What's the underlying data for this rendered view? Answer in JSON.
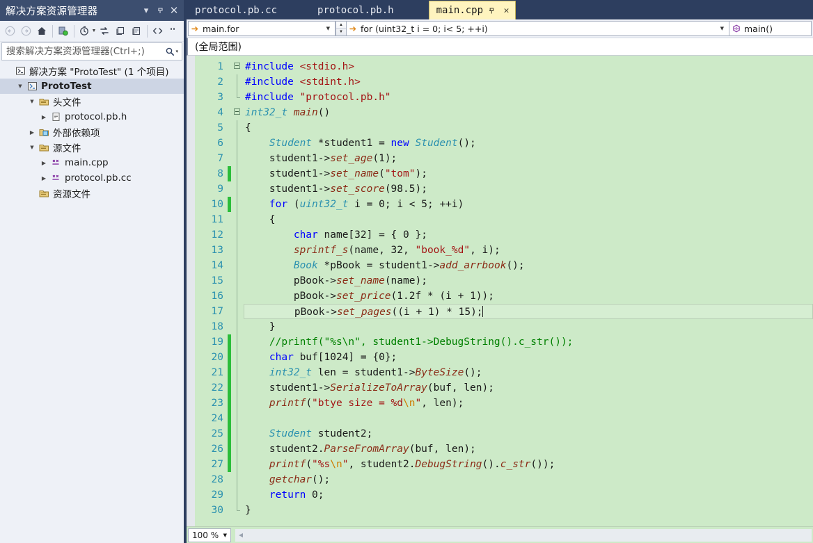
{
  "solution_explorer": {
    "title": "解决方案资源管理器",
    "title_buttons": [
      {
        "name": "dropdown-icon",
        "glyph": "▾"
      },
      {
        "name": "pin-icon",
        "glyph": "⚲"
      },
      {
        "name": "close-icon",
        "glyph": "✕"
      }
    ],
    "toolbar": [
      {
        "name": "back-icon",
        "tip": "后退"
      },
      {
        "name": "forward-icon",
        "tip": "前进"
      },
      {
        "name": "home-icon",
        "tip": "主页"
      },
      {
        "name": "sync-with-active-document-icon",
        "tip": "与活动文档同步"
      },
      {
        "name": "refresh-icon",
        "tip": "刷新"
      },
      {
        "name": "collapse-all-icon",
        "tip": "全部折叠"
      },
      {
        "name": "show-all-files-icon",
        "tip": "显示所有文件"
      },
      {
        "name": "properties-icon",
        "tip": "属性"
      },
      {
        "name": "code-view-icon",
        "tip": "查看代码"
      },
      {
        "name": "overflow-icon",
        "tip": "更多"
      }
    ],
    "search": {
      "placeholder": "搜索解决方案资源管理器(Ctrl+;)",
      "value": "",
      "icon": "search-icon",
      "caret": "▾"
    },
    "tree": [
      {
        "indent": 0,
        "twisty": "",
        "icon": "solution-icon",
        "label": "解决方案 \"ProtoTest\" (1 个项目)",
        "bold": false,
        "selected": false
      },
      {
        "indent": 1,
        "twisty": "▲",
        "icon": "cpp-project-icon",
        "label": "ProtoTest",
        "bold": true,
        "selected": true
      },
      {
        "indent": 2,
        "twisty": "▲",
        "icon": "filter-folder-icon",
        "label": "头文件",
        "bold": false,
        "selected": false
      },
      {
        "indent": 3,
        "twisty": "▶",
        "icon": "header-file-icon",
        "label": "protocol.pb.h",
        "bold": false,
        "selected": false
      },
      {
        "indent": 2,
        "twisty": "▶",
        "icon": "external-deps-icon",
        "label": "外部依赖项",
        "bold": false,
        "selected": false
      },
      {
        "indent": 2,
        "twisty": "▲",
        "icon": "filter-folder-icon",
        "label": "源文件",
        "bold": false,
        "selected": false
      },
      {
        "indent": 3,
        "twisty": "▶",
        "icon": "cpp-file-icon",
        "label": "main.cpp",
        "bold": false,
        "selected": false
      },
      {
        "indent": 3,
        "twisty": "▶",
        "icon": "cpp-file-icon",
        "label": "protocol.pb.cc",
        "bold": false,
        "selected": false
      },
      {
        "indent": 2,
        "twisty": "",
        "icon": "filter-folder-icon",
        "label": "资源文件",
        "bold": false,
        "selected": false
      }
    ]
  },
  "editor": {
    "tabs": [
      {
        "label": "protocol.pb.cc",
        "active": false
      },
      {
        "label": "protocol.pb.h",
        "active": false
      },
      {
        "label": "main.cpp",
        "active": true,
        "pin_glyph": "⚲",
        "close_glyph": "✕"
      }
    ],
    "navbar": {
      "left_value": "main.for",
      "left_icon": "arrow-right-icon",
      "mid_value": "for (uint32_t i = 0; i< 5; ++i)",
      "mid_icon": "arrow-right-icon",
      "right_value": "main()",
      "right_icon": "method-icon",
      "caret_glyph": "▾",
      "spinner_up": "▲",
      "spinner_down": "▼"
    },
    "scope_bar": {
      "value": "(全局范围)"
    },
    "zoom": {
      "value": "100 %",
      "caret": "▾"
    },
    "change_bar_lines": [
      8,
      10,
      19,
      20,
      21,
      22,
      23,
      24,
      25,
      26,
      27
    ],
    "current_line": 17,
    "fold_lines": [
      1,
      4
    ],
    "code": [
      {
        "n": 1,
        "tokens": [
          {
            "t": "ppk",
            "v": "#include"
          },
          {
            "t": "op",
            "v": " "
          },
          {
            "t": "str",
            "v": "<stdio.h>"
          }
        ]
      },
      {
        "n": 2,
        "tokens": [
          {
            "t": "ppk",
            "v": "#include"
          },
          {
            "t": "op",
            "v": " "
          },
          {
            "t": "str",
            "v": "<stdint.h>"
          }
        ]
      },
      {
        "n": 3,
        "tokens": [
          {
            "t": "ppk",
            "v": "#include"
          },
          {
            "t": "op",
            "v": " "
          },
          {
            "t": "str",
            "v": "\"protocol.pb.h\""
          }
        ]
      },
      {
        "n": 4,
        "tokens": [
          {
            "t": "typ",
            "v": "int32_t"
          },
          {
            "t": "op",
            "v": " "
          },
          {
            "t": "gfn",
            "v": "main"
          },
          {
            "t": "op",
            "v": "()"
          }
        ]
      },
      {
        "n": 5,
        "tokens": [
          {
            "t": "op",
            "v": "{"
          }
        ]
      },
      {
        "n": 6,
        "tokens": [
          {
            "t": "op",
            "v": "    "
          },
          {
            "t": "typ",
            "v": "Student"
          },
          {
            "t": "op",
            "v": " *"
          },
          {
            "t": "id",
            "v": "student1"
          },
          {
            "t": "op",
            "v": " = "
          },
          {
            "t": "k",
            "v": "new"
          },
          {
            "t": "op",
            "v": " "
          },
          {
            "t": "typ",
            "v": "Student"
          },
          {
            "t": "op",
            "v": "();"
          }
        ]
      },
      {
        "n": 7,
        "tokens": [
          {
            "t": "op",
            "v": "    "
          },
          {
            "t": "id",
            "v": "student1"
          },
          {
            "t": "op",
            "v": "->"
          },
          {
            "t": "fn",
            "v": "set_age"
          },
          {
            "t": "op",
            "v": "("
          },
          {
            "t": "num",
            "v": "1"
          },
          {
            "t": "op",
            "v": ");"
          }
        ]
      },
      {
        "n": 8,
        "tokens": [
          {
            "t": "op",
            "v": "    "
          },
          {
            "t": "id",
            "v": "student1"
          },
          {
            "t": "op",
            "v": "->"
          },
          {
            "t": "fn",
            "v": "set_name"
          },
          {
            "t": "op",
            "v": "("
          },
          {
            "t": "str",
            "v": "\"tom\""
          },
          {
            "t": "op",
            "v": ");"
          }
        ]
      },
      {
        "n": 9,
        "tokens": [
          {
            "t": "op",
            "v": "    "
          },
          {
            "t": "id",
            "v": "student1"
          },
          {
            "t": "op",
            "v": "->"
          },
          {
            "t": "fn",
            "v": "set_score"
          },
          {
            "t": "op",
            "v": "("
          },
          {
            "t": "num",
            "v": "98.5"
          },
          {
            "t": "op",
            "v": ");"
          }
        ]
      },
      {
        "n": 10,
        "tokens": [
          {
            "t": "op",
            "v": "    "
          },
          {
            "t": "k",
            "v": "for"
          },
          {
            "t": "op",
            "v": " ("
          },
          {
            "t": "typ",
            "v": "uint32_t"
          },
          {
            "t": "op",
            "v": " "
          },
          {
            "t": "id",
            "v": "i"
          },
          {
            "t": "op",
            "v": " = "
          },
          {
            "t": "num",
            "v": "0"
          },
          {
            "t": "op",
            "v": "; "
          },
          {
            "t": "id",
            "v": "i"
          },
          {
            "t": "op",
            "v": " < "
          },
          {
            "t": "num",
            "v": "5"
          },
          {
            "t": "op",
            "v": "; ++"
          },
          {
            "t": "id",
            "v": "i"
          },
          {
            "t": "op",
            "v": ")"
          }
        ]
      },
      {
        "n": 11,
        "tokens": [
          {
            "t": "op",
            "v": "    {"
          }
        ]
      },
      {
        "n": 12,
        "tokens": [
          {
            "t": "op",
            "v": "        "
          },
          {
            "t": "k",
            "v": "char"
          },
          {
            "t": "op",
            "v": " "
          },
          {
            "t": "id",
            "v": "name"
          },
          {
            "t": "op",
            "v": "["
          },
          {
            "t": "num",
            "v": "32"
          },
          {
            "t": "op",
            "v": "] = { "
          },
          {
            "t": "num",
            "v": "0"
          },
          {
            "t": "op",
            "v": " };"
          }
        ]
      },
      {
        "n": 13,
        "tokens": [
          {
            "t": "op",
            "v": "        "
          },
          {
            "t": "gfn",
            "v": "sprintf_s"
          },
          {
            "t": "op",
            "v": "("
          },
          {
            "t": "id",
            "v": "name"
          },
          {
            "t": "op",
            "v": ", "
          },
          {
            "t": "num",
            "v": "32"
          },
          {
            "t": "op",
            "v": ", "
          },
          {
            "t": "str",
            "v": "\"book_%d\""
          },
          {
            "t": "op",
            "v": ", "
          },
          {
            "t": "id",
            "v": "i"
          },
          {
            "t": "op",
            "v": ");"
          }
        ]
      },
      {
        "n": 14,
        "tokens": [
          {
            "t": "op",
            "v": "        "
          },
          {
            "t": "typ",
            "v": "Book"
          },
          {
            "t": "op",
            "v": " *"
          },
          {
            "t": "id",
            "v": "pBook"
          },
          {
            "t": "op",
            "v": " = "
          },
          {
            "t": "id",
            "v": "student1"
          },
          {
            "t": "op",
            "v": "->"
          },
          {
            "t": "fn",
            "v": "add_arrbook"
          },
          {
            "t": "op",
            "v": "();"
          }
        ]
      },
      {
        "n": 15,
        "tokens": [
          {
            "t": "op",
            "v": "        "
          },
          {
            "t": "id",
            "v": "pBook"
          },
          {
            "t": "op",
            "v": "->"
          },
          {
            "t": "fn",
            "v": "set_name"
          },
          {
            "t": "op",
            "v": "("
          },
          {
            "t": "id",
            "v": "name"
          },
          {
            "t": "op",
            "v": ");"
          }
        ]
      },
      {
        "n": 16,
        "tokens": [
          {
            "t": "op",
            "v": "        "
          },
          {
            "t": "id",
            "v": "pBook"
          },
          {
            "t": "op",
            "v": "->"
          },
          {
            "t": "fn",
            "v": "set_price"
          },
          {
            "t": "op",
            "v": "("
          },
          {
            "t": "num",
            "v": "1.2f"
          },
          {
            "t": "op",
            "v": " * ("
          },
          {
            "t": "id",
            "v": "i"
          },
          {
            "t": "op",
            "v": " + "
          },
          {
            "t": "num",
            "v": "1"
          },
          {
            "t": "op",
            "v": "));"
          }
        ]
      },
      {
        "n": 17,
        "tokens": [
          {
            "t": "op",
            "v": "        "
          },
          {
            "t": "id",
            "v": "pBook"
          },
          {
            "t": "op",
            "v": "->"
          },
          {
            "t": "fn",
            "v": "set_pages"
          },
          {
            "t": "op",
            "v": "(("
          },
          {
            "t": "id",
            "v": "i"
          },
          {
            "t": "op",
            "v": " + "
          },
          {
            "t": "num",
            "v": "1"
          },
          {
            "t": "op",
            "v": ") * "
          },
          {
            "t": "num",
            "v": "15"
          },
          {
            "t": "op",
            "v": ");"
          },
          {
            "t": "caret",
            "v": ""
          }
        ]
      },
      {
        "n": 18,
        "tokens": [
          {
            "t": "op",
            "v": "    }"
          }
        ]
      },
      {
        "n": 19,
        "tokens": [
          {
            "t": "cmt",
            "v": "    //printf(\"%s\\n\", student1->DebugString().c_str());"
          }
        ]
      },
      {
        "n": 20,
        "tokens": [
          {
            "t": "op",
            "v": "    "
          },
          {
            "t": "k",
            "v": "char"
          },
          {
            "t": "op",
            "v": " "
          },
          {
            "t": "id",
            "v": "buf"
          },
          {
            "t": "op",
            "v": "["
          },
          {
            "t": "num",
            "v": "1024"
          },
          {
            "t": "op",
            "v": "] = {"
          },
          {
            "t": "num",
            "v": "0"
          },
          {
            "t": "op",
            "v": "};"
          }
        ]
      },
      {
        "n": 21,
        "tokens": [
          {
            "t": "op",
            "v": "    "
          },
          {
            "t": "typ",
            "v": "int32_t"
          },
          {
            "t": "op",
            "v": " "
          },
          {
            "t": "id",
            "v": "len"
          },
          {
            "t": "op",
            "v": " = "
          },
          {
            "t": "id",
            "v": "student1"
          },
          {
            "t": "op",
            "v": "->"
          },
          {
            "t": "fn",
            "v": "ByteSize"
          },
          {
            "t": "op",
            "v": "();"
          }
        ]
      },
      {
        "n": 22,
        "tokens": [
          {
            "t": "op",
            "v": "    "
          },
          {
            "t": "id",
            "v": "student1"
          },
          {
            "t": "op",
            "v": "->"
          },
          {
            "t": "fn",
            "v": "SerializeToArray"
          },
          {
            "t": "op",
            "v": "("
          },
          {
            "t": "id",
            "v": "buf"
          },
          {
            "t": "op",
            "v": ", "
          },
          {
            "t": "id",
            "v": "len"
          },
          {
            "t": "op",
            "v": ");"
          }
        ]
      },
      {
        "n": 23,
        "tokens": [
          {
            "t": "op",
            "v": "    "
          },
          {
            "t": "gfn",
            "v": "printf"
          },
          {
            "t": "op",
            "v": "("
          },
          {
            "t": "str",
            "v": "\"btye size = %d"
          },
          {
            "t": "esc",
            "v": "\\n"
          },
          {
            "t": "str",
            "v": "\""
          },
          {
            "t": "op",
            "v": ", "
          },
          {
            "t": "id",
            "v": "len"
          },
          {
            "t": "op",
            "v": ");"
          }
        ]
      },
      {
        "n": 24,
        "tokens": [
          {
            "t": "op",
            "v": ""
          }
        ]
      },
      {
        "n": 25,
        "tokens": [
          {
            "t": "op",
            "v": "    "
          },
          {
            "t": "typ",
            "v": "Student"
          },
          {
            "t": "op",
            "v": " "
          },
          {
            "t": "id",
            "v": "student2"
          },
          {
            "t": "op",
            "v": ";"
          }
        ]
      },
      {
        "n": 26,
        "tokens": [
          {
            "t": "op",
            "v": "    "
          },
          {
            "t": "id",
            "v": "student2"
          },
          {
            "t": "op",
            "v": "."
          },
          {
            "t": "fn",
            "v": "ParseFromArray"
          },
          {
            "t": "op",
            "v": "("
          },
          {
            "t": "id",
            "v": "buf"
          },
          {
            "t": "op",
            "v": ", "
          },
          {
            "t": "id",
            "v": "len"
          },
          {
            "t": "op",
            "v": ");"
          }
        ]
      },
      {
        "n": 27,
        "tokens": [
          {
            "t": "op",
            "v": "    "
          },
          {
            "t": "gfn",
            "v": "printf"
          },
          {
            "t": "op",
            "v": "("
          },
          {
            "t": "str",
            "v": "\"%s"
          },
          {
            "t": "esc",
            "v": "\\n"
          },
          {
            "t": "str",
            "v": "\""
          },
          {
            "t": "op",
            "v": ", "
          },
          {
            "t": "id",
            "v": "student2"
          },
          {
            "t": "op",
            "v": "."
          },
          {
            "t": "fn",
            "v": "DebugString"
          },
          {
            "t": "op",
            "v": "()."
          },
          {
            "t": "fn",
            "v": "c_str"
          },
          {
            "t": "op",
            "v": "());"
          }
        ]
      },
      {
        "n": 28,
        "tokens": [
          {
            "t": "op",
            "v": "    "
          },
          {
            "t": "gfn",
            "v": "getchar"
          },
          {
            "t": "op",
            "v": "();"
          }
        ]
      },
      {
        "n": 29,
        "tokens": [
          {
            "t": "op",
            "v": "    "
          },
          {
            "t": "k",
            "v": "return"
          },
          {
            "t": "op",
            "v": " "
          },
          {
            "t": "num",
            "v": "0"
          },
          {
            "t": "op",
            "v": ";"
          }
        ]
      },
      {
        "n": 30,
        "tokens": [
          {
            "t": "op",
            "v": "}"
          }
        ]
      }
    ]
  },
  "colors": {
    "editor_bg": "#cdeac8",
    "active_tab_bg": "#fff4bf",
    "chrome_bg": "#2d3e5f",
    "panel_bg": "#eef1f7",
    "change_bar": "#2bbd3a",
    "linenum": "#2b91af"
  }
}
